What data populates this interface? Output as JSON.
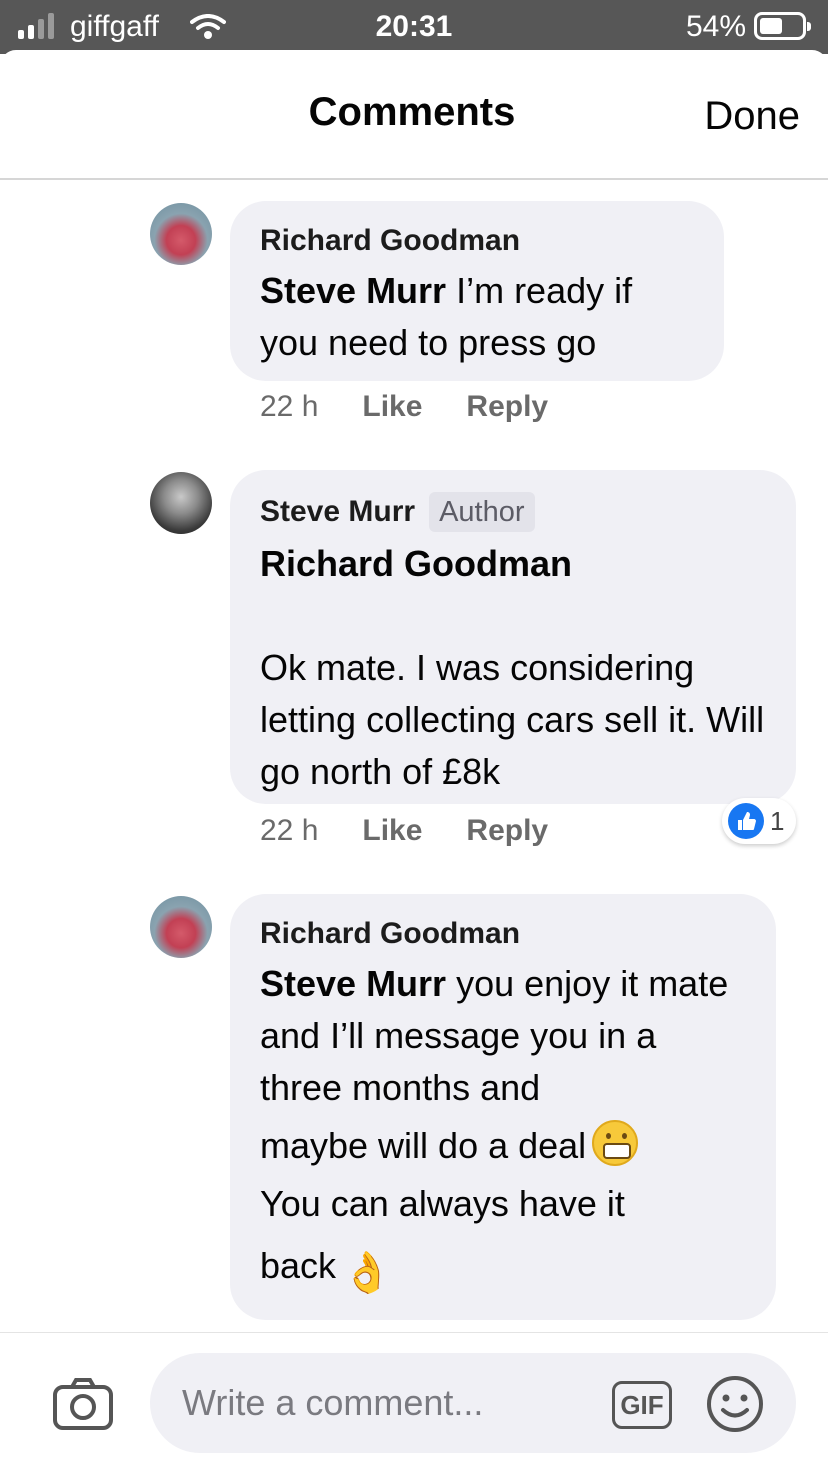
{
  "status_bar": {
    "carrier": "giffgaff",
    "time": "20:31",
    "battery": "54%"
  },
  "header": {
    "title": "Comments",
    "done_label": "Done"
  },
  "comments": [
    {
      "author": "Richard Goodman",
      "mention": "Steve Murr",
      "text": " I’m ready if you need to press go",
      "time": "22 h",
      "like_label": "Like",
      "reply_label": "Reply"
    },
    {
      "author": "Steve Murr",
      "badge": "Author",
      "mention": "Richard Goodman",
      "text": "Ok mate. I was considering letting collecting cars sell it. Will go north of £8k",
      "time": "22 h",
      "like_label": "Like",
      "reply_label": "Reply",
      "reaction_count": "1"
    },
    {
      "author": "Richard Goodman",
      "mention": "Steve Murr",
      "text_1": " you enjoy it mate and I’ll message you in a three months and",
      "text_2": "maybe will do a deal",
      "text_3": "You can always have it",
      "text_4": "back"
    }
  ],
  "composer": {
    "placeholder": "Write a comment...",
    "gif_label": "GIF"
  },
  "icons": {
    "signal": "signal-icon",
    "wifi": "wifi-icon",
    "battery": "battery-icon",
    "camera": "camera-icon",
    "emoji": "emoji-icon",
    "like": "thumbs-up-icon"
  },
  "colors": {
    "bubble": "#f0f0f5",
    "like_blue": "#1877f2",
    "status_bar": "#575757"
  }
}
